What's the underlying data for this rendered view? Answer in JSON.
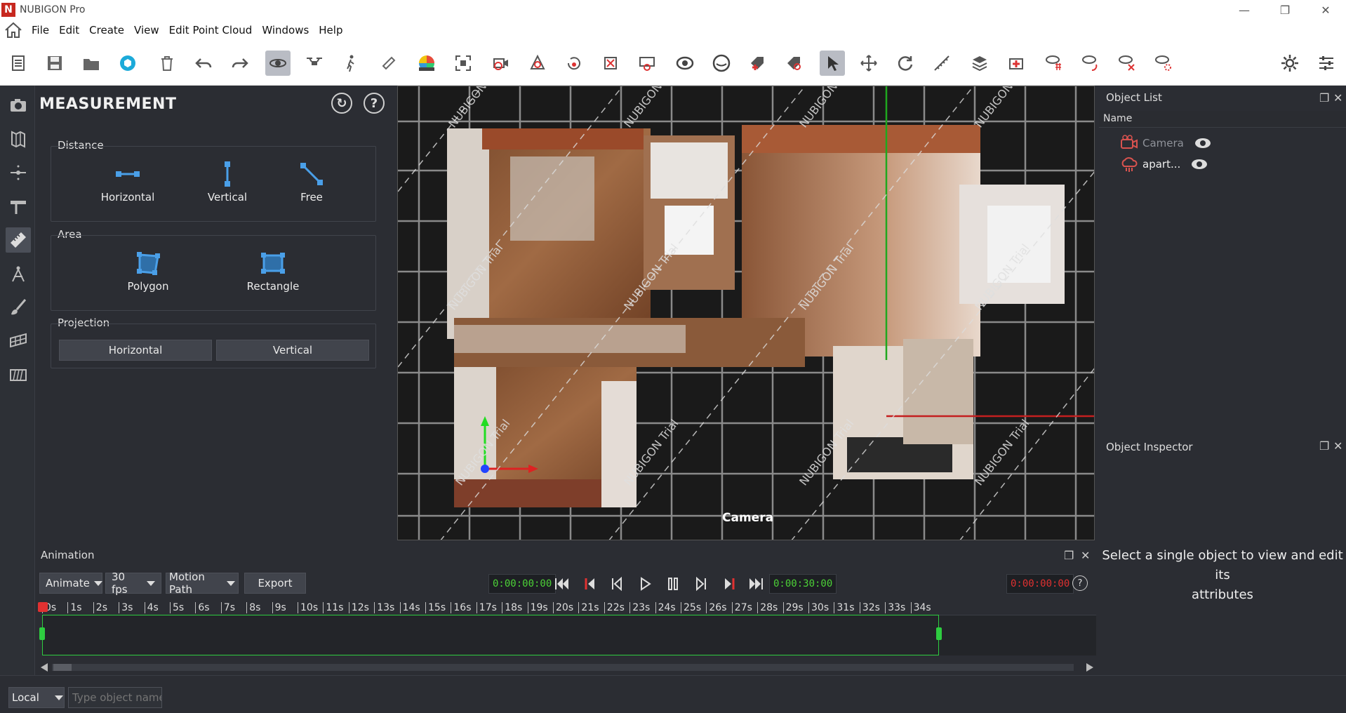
{
  "window": {
    "title": "NUBIGON Pro",
    "logo_letter": "N",
    "minimize": "—",
    "maximize": "❐",
    "close": "✕"
  },
  "menu": {
    "items": [
      "File",
      "Edit",
      "Create",
      "View",
      "Edit Point Cloud",
      "Windows",
      "Help"
    ]
  },
  "measurement": {
    "title": "MEASUREMENT",
    "distance": {
      "label": "Distance",
      "horizontal": "Horizontal",
      "vertical": "Vertical",
      "free": "Free"
    },
    "area": {
      "label": "Area",
      "polygon": "Polygon",
      "rectangle": "Rectangle"
    },
    "projection": {
      "label": "Projection",
      "horizontal": "Horizontal",
      "vertical": "Vertical"
    },
    "help": "?"
  },
  "viewport": {
    "camera_label": "Camera",
    "watermark": "NUBIGON Trial"
  },
  "object_list": {
    "title": "Object List",
    "column_name": "Name",
    "items": [
      {
        "name": "Camera"
      },
      {
        "name": "apart..."
      }
    ]
  },
  "object_inspector": {
    "title": "Object Inspector",
    "message_line1": "Select a single object to view and edit its",
    "message_line2": "attributes"
  },
  "animation": {
    "title": "Animation",
    "mode": "Animate",
    "fps": "30 fps",
    "path": "Motion Path",
    "export": "Export",
    "start_time": "0:00:00:00",
    "end_time": "0:00:30:00",
    "current_time": "0:00:00:00",
    "help": "?",
    "ruler": [
      "0s",
      "1s",
      "2s",
      "3s",
      "4s",
      "5s",
      "6s",
      "7s",
      "8s",
      "9s",
      "10s",
      "11s",
      "12s",
      "13s",
      "14s",
      "15s",
      "16s",
      "17s",
      "18s",
      "19s",
      "20s",
      "21s",
      "22s",
      "23s",
      "24s",
      "25s",
      "26s",
      "27s",
      "28s",
      "29s",
      "30s",
      "31s",
      "32s",
      "33s",
      "34s"
    ]
  },
  "bottom": {
    "coord_mode": "Local",
    "object_name_placeholder": "Type object name"
  },
  "colors": {
    "accent_green": "#4cd137",
    "accent_red": "#e03131",
    "tool_blue": "#4a9fe8",
    "object_red": "#d9534f"
  }
}
